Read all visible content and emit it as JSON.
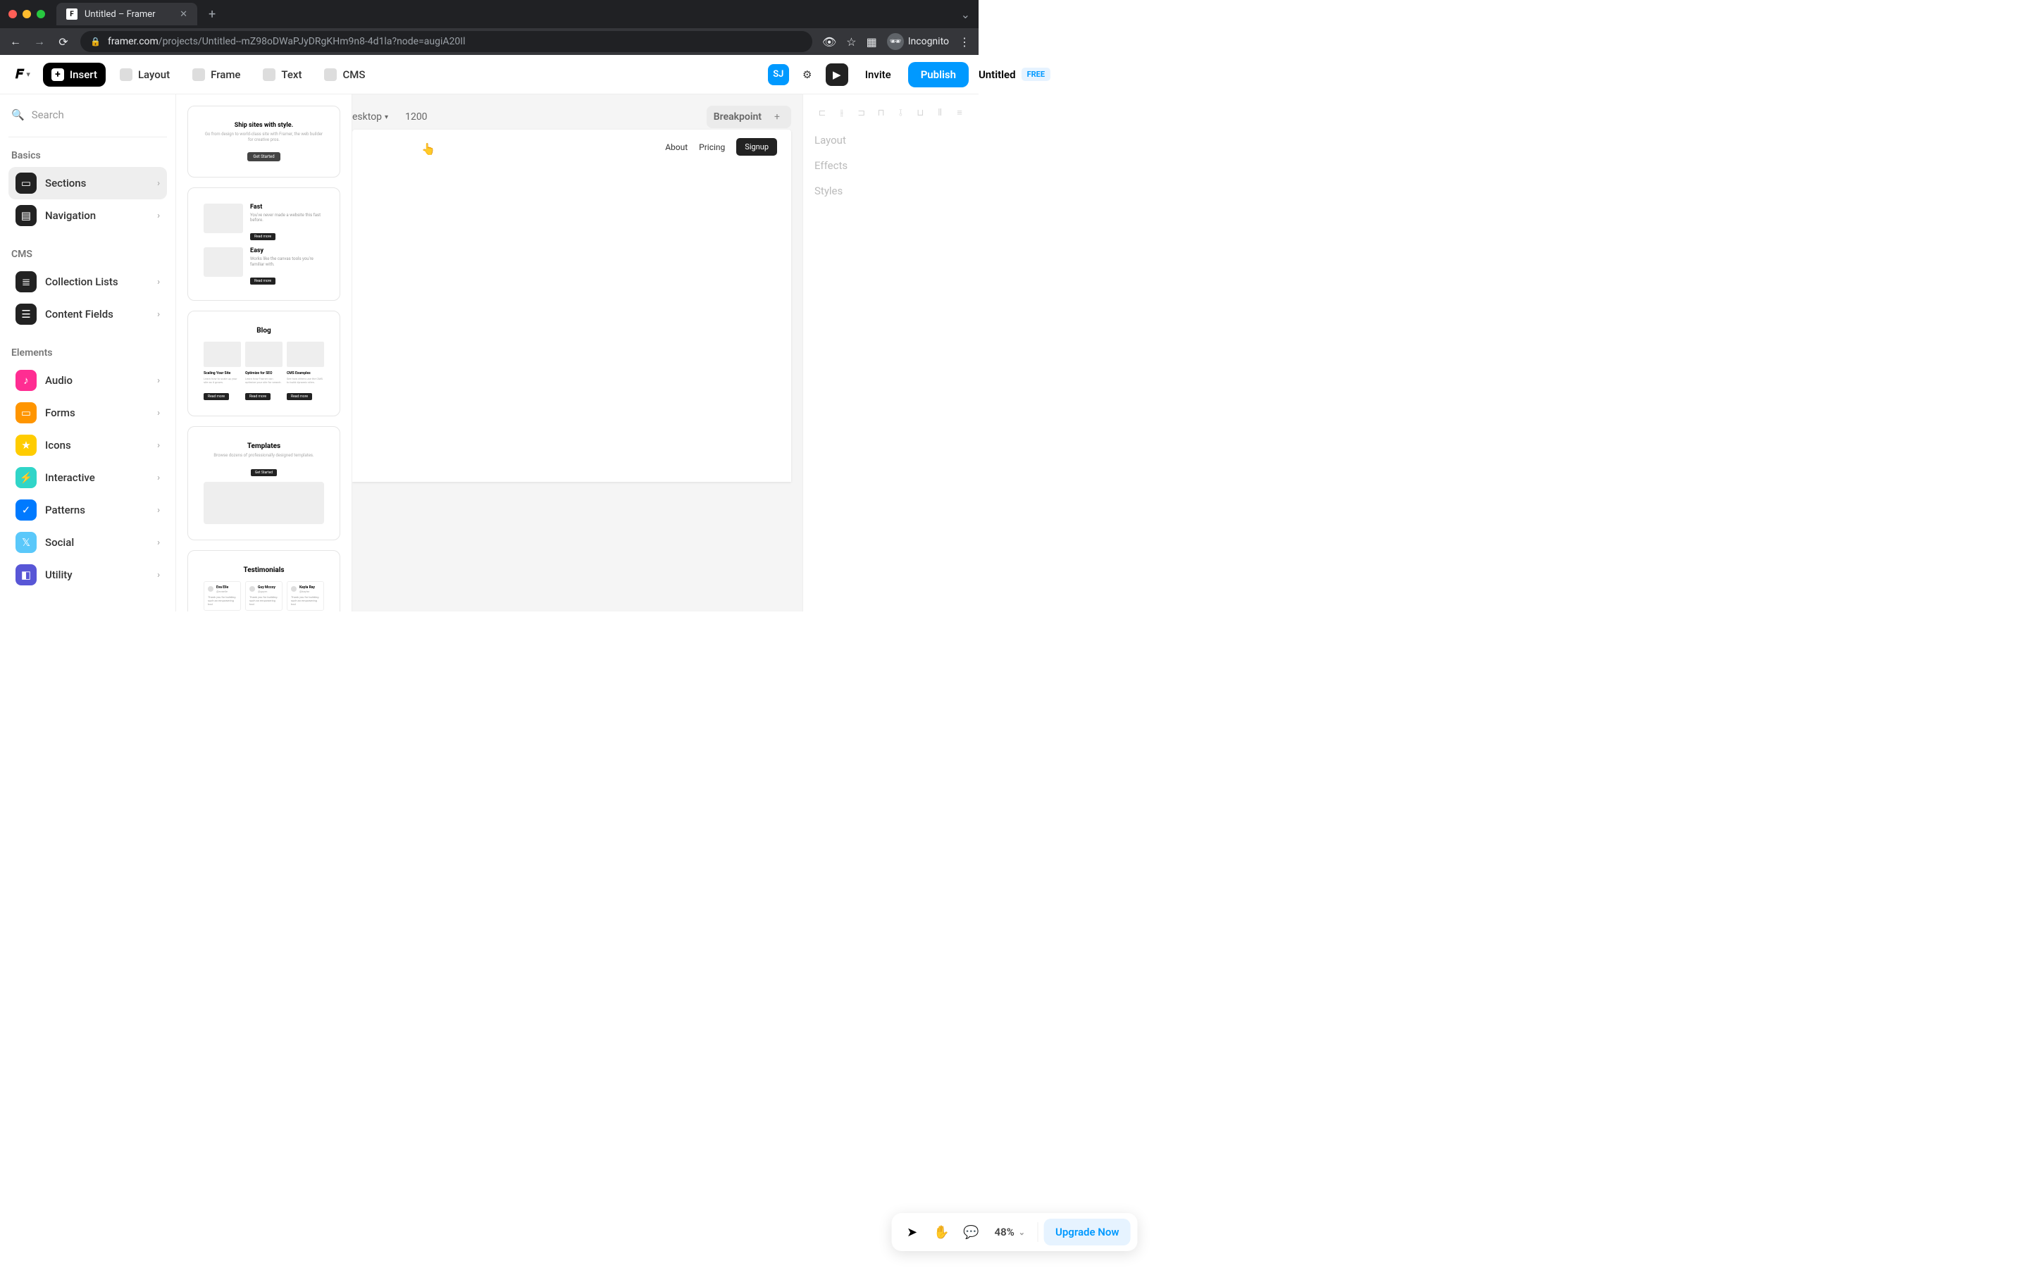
{
  "browser": {
    "tab_title": "Untitled – Framer",
    "url_domain": "framer.com",
    "url_path": "/projects/Untitled--mZ98oDWaPJyDRgKHm9n8-4d1la?node=augiA20Il",
    "profile_label": "Incognito"
  },
  "toolbar": {
    "insert": "Insert",
    "layout": "Layout",
    "frame": "Frame",
    "text": "Text",
    "cms": "CMS",
    "doc_title": "Untitled",
    "free_badge": "FREE",
    "avatar": "SJ",
    "invite": "Invite",
    "publish": "Publish"
  },
  "sidebar": {
    "search_placeholder": "Search",
    "groups": {
      "basics": "Basics",
      "cms": "CMS",
      "elements": "Elements"
    },
    "items": {
      "sections": "Sections",
      "navigation": "Navigation",
      "collection_lists": "Collection Lists",
      "content_fields": "Content Fields",
      "audio": "Audio",
      "forms": "Forms",
      "icons": "Icons",
      "interactive": "Interactive",
      "patterns": "Patterns",
      "social": "Social",
      "utility": "Utility"
    }
  },
  "section_previews": {
    "hero": {
      "title": "Ship sites with style.",
      "sub": "Go from design to world-class site with Framer, the web builder for creative pros.",
      "cta": "Get Started"
    },
    "features": [
      {
        "title": "Fast",
        "sub": "You've never made a website this fast before.",
        "cta": "Read more"
      },
      {
        "title": "Easy",
        "sub": "Works like the canvas tools you're familiar with.",
        "cta": "Read more"
      }
    ],
    "blog": {
      "title": "Blog",
      "cards": [
        {
          "h": "Scaling Your Site",
          "p": "Learn how to scale up your site as it grows.",
          "cta": "Read more"
        },
        {
          "h": "Optimize for SEO",
          "p": "Learn how Framer can optimize your site for search.",
          "cta": "Read more"
        },
        {
          "h": "CMS Examples",
          "p": "See how others use the CMS to build dynamic sites.",
          "cta": "Read more"
        }
      ]
    },
    "templates": {
      "title": "Templates",
      "sub": "Browse dozens of professionally designed templates.",
      "cta": "Get Started"
    },
    "testimonials": {
      "title": "Testimonials",
      "cards": [
        {
          "name": "Eva Elle",
          "role": "@evaelle",
          "text": "Thank you for building such an empowering tool"
        },
        {
          "name": "Guy Mccoy",
          "role": "@guym",
          "text": "Thank you for building such an empowering tool"
        },
        {
          "name": "Kayla Ray",
          "role": "@kaylar",
          "text": "Thank you for building such an empowering tool"
        }
      ]
    }
  },
  "canvas": {
    "breakpoint_label": "esktop",
    "width": "1200",
    "breakpoint_button": "Breakpoint",
    "nav_links": [
      "About",
      "Pricing"
    ],
    "nav_cta": "Signup"
  },
  "right_panel": {
    "layout": "Layout",
    "effects": "Effects",
    "styles": "Styles"
  },
  "bottom": {
    "zoom": "48%",
    "upgrade": "Upgrade Now"
  }
}
